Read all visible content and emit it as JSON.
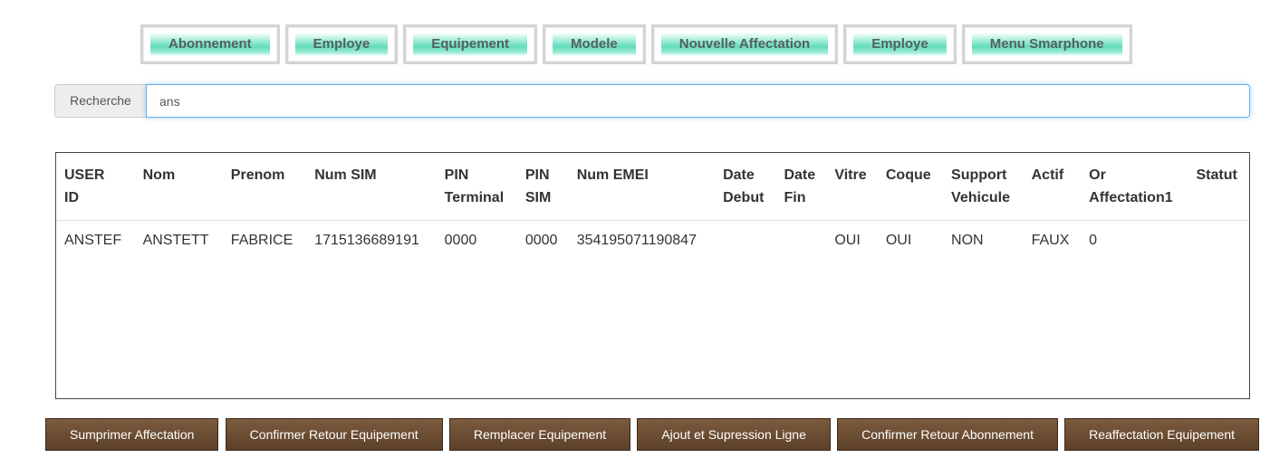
{
  "nav": {
    "items": [
      {
        "label": "Abonnement"
      },
      {
        "label": "Employe"
      },
      {
        "label": "Equipement"
      },
      {
        "label": "Modele"
      },
      {
        "label": "Nouvelle Affectation"
      },
      {
        "label": "Employe"
      },
      {
        "label": "Menu Smarphone"
      }
    ]
  },
  "search": {
    "label": "Recherche",
    "value": "ans"
  },
  "table": {
    "headers": [
      [
        "USER",
        "ID"
      ],
      [
        "Nom",
        ""
      ],
      [
        "Prenom",
        ""
      ],
      [
        "Num SIM",
        ""
      ],
      [
        "PIN",
        "Terminal"
      ],
      [
        "PIN",
        "SIM"
      ],
      [
        "Num EMEI",
        ""
      ],
      [
        "Date",
        "Debut"
      ],
      [
        "Date",
        "Fin"
      ],
      [
        "Vitre",
        ""
      ],
      [
        "Coque",
        ""
      ],
      [
        "Support",
        "Vehicule"
      ],
      [
        "Actif",
        ""
      ],
      [
        "Or",
        "Affectation1"
      ],
      [
        "Statut",
        ""
      ]
    ],
    "rows": [
      [
        "ANSTEF",
        "ANSTETT",
        "FABRICE",
        "1715136689191",
        "0000",
        "0000",
        "354195071190847",
        "",
        "",
        "OUI",
        "OUI",
        "NON",
        "FAUX",
        "0",
        ""
      ]
    ]
  },
  "actions": {
    "buttons": [
      {
        "label": "Sumprimer Affectation"
      },
      {
        "label": "Confirmer Retour Equipement"
      },
      {
        "label": "Remplacer Equipement"
      },
      {
        "label": "Ajout et Supression Ligne"
      },
      {
        "label": "Confirmer Retour Abonnement"
      },
      {
        "label": "Reaffectation Equipement"
      }
    ]
  }
}
